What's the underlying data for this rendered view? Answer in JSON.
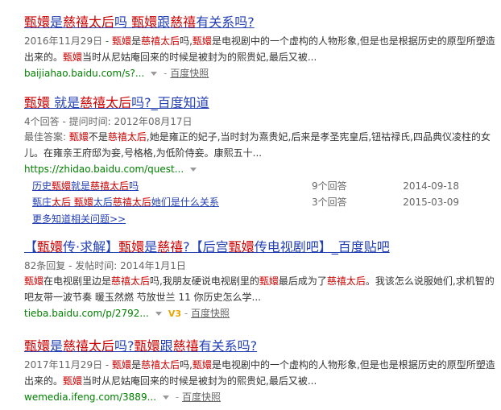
{
  "r1": {
    "title_parts": [
      {
        "t": "甄嬛",
        "h": true
      },
      {
        "t": "是",
        "h": false
      },
      {
        "t": "慈禧太后",
        "h": true
      },
      {
        "t": "吗 ",
        "h": false
      },
      {
        "t": "甄嬛",
        "h": true
      },
      {
        "t": "跟",
        "h": false
      },
      {
        "t": "慈禧",
        "h": true
      },
      {
        "t": "有关系吗?",
        "h": false
      }
    ],
    "abstract_parts": [
      {
        "t": "2016年11月29日 - ",
        "h": false,
        "c": "#666"
      },
      {
        "t": "甄嬛",
        "h": true
      },
      {
        "t": "是",
        "h": false
      },
      {
        "t": "慈禧太后",
        "h": true
      },
      {
        "t": "吗,",
        "h": false
      },
      {
        "t": "甄嬛",
        "h": true
      },
      {
        "t": "是电视剧中的一个虚构的人物形象,但是也是根据历史的原型所塑造出来的。",
        "h": false
      },
      {
        "t": "甄嬛",
        "h": true
      },
      {
        "t": "当时从尼姑庵回来的时候是被封为的熙贵妃,最后又被...",
        "h": false
      }
    ],
    "url": "baijiahao.baidu.com/s?...",
    "snapshot": "百度快照"
  },
  "r2": {
    "title_parts": [
      {
        "t": "甄嬛",
        "h": true
      },
      {
        "t": " 就是",
        "h": false
      },
      {
        "t": "慈禧太后",
        "h": true
      },
      {
        "t": "吗?_百度知道",
        "h": false
      }
    ],
    "meta": "4个回答 - 提问时间: 2012年08月17日",
    "abstract_parts": [
      {
        "t": "最佳答案: ",
        "h": false,
        "c": "#666"
      },
      {
        "t": "甄嬛",
        "h": true
      },
      {
        "t": "不是",
        "h": false
      },
      {
        "t": "慈禧太后",
        "h": true
      },
      {
        "t": ",她是雍正的妃子,当时封为熹贵妃,后来是孝圣宪皇后,钮祜禄氏,四品典仪凌柱的女儿。在雍亲王府邸为妾,号格格,为低阶侍妾。康熙五十...",
        "h": false
      }
    ],
    "url": "https://zhidao.baidu.com/quest...",
    "related": [
      {
        "q_parts": [
          {
            "t": "历史",
            "h": false
          },
          {
            "t": "甄嬛",
            "h": true
          },
          {
            "t": "就是",
            "h": false
          },
          {
            "t": "慈禧太后",
            "h": true
          },
          {
            "t": "吗",
            "h": false
          }
        ],
        "count": "9个回答",
        "date": "2014-09-18"
      },
      {
        "q_parts": [
          {
            "t": "甄庄",
            "h": false
          },
          {
            "t": "太后",
            "h": true
          },
          {
            "t": " ",
            "h": false
          },
          {
            "t": "甄嬛",
            "h": true
          },
          {
            "t": "太后",
            "h": false
          },
          {
            "t": "慈禧太后",
            "h": true
          },
          {
            "t": "她们是什么关系",
            "h": false
          }
        ],
        "count": "3个回答",
        "date": "2015-03-09"
      }
    ],
    "more": "更多知道相关问题>>"
  },
  "r3": {
    "title_parts": [
      {
        "t": "【",
        "h": false
      },
      {
        "t": "甄嬛",
        "h": true
      },
      {
        "t": "传·求解】",
        "h": false
      },
      {
        "t": "甄嬛",
        "h": true
      },
      {
        "t": "是",
        "h": false
      },
      {
        "t": "慈禧",
        "h": true
      },
      {
        "t": "?【后宫",
        "h": false
      },
      {
        "t": "甄嬛",
        "h": true
      },
      {
        "t": "传电视剧吧】_百度贴吧",
        "h": false
      }
    ],
    "meta": "82条回复 - 发帖时间: 2014年1月1日",
    "abstract_parts": [
      {
        "t": "甄嬛",
        "h": true
      },
      {
        "t": "在电视剧里边是",
        "h": false
      },
      {
        "t": "慈禧太后",
        "h": true
      },
      {
        "t": "吗,我朋友硬说电视剧里的",
        "h": false
      },
      {
        "t": "甄嬛",
        "h": true
      },
      {
        "t": "最后成为了",
        "h": false
      },
      {
        "t": "慈禧太后",
        "h": true
      },
      {
        "t": "。我该怎么说服她们,求机智的吧友带一波节奏 暖玉然燃 芍放世兰 11 你历史怎么学...",
        "h": false
      }
    ],
    "url": "tieba.baidu.com/p/2792...",
    "badge": "V3",
    "snapshot": "百度快照"
  },
  "r4": {
    "title_parts": [
      {
        "t": "甄嬛",
        "h": true
      },
      {
        "t": "是",
        "h": false
      },
      {
        "t": "慈禧太后",
        "h": true
      },
      {
        "t": "吗?",
        "h": false
      },
      {
        "t": "甄嬛",
        "h": true
      },
      {
        "t": "跟",
        "h": false
      },
      {
        "t": "慈禧",
        "h": true
      },
      {
        "t": "有关系吗?",
        "h": false
      }
    ],
    "abstract_parts": [
      {
        "t": "2017年11月29日 - ",
        "h": false,
        "c": "#666"
      },
      {
        "t": "甄嬛",
        "h": true
      },
      {
        "t": "是",
        "h": false
      },
      {
        "t": "慈禧太后",
        "h": true
      },
      {
        "t": "吗,",
        "h": false
      },
      {
        "t": "甄嬛",
        "h": true
      },
      {
        "t": "是电视剧中的一个虚构的人物形象,但是也是根据历史的原型所塑造出来的。",
        "h": false
      },
      {
        "t": "甄嬛",
        "h": true
      },
      {
        "t": "当时从尼姑庵回来的时候是被封为的熙贵妃,最后又被...",
        "h": false
      }
    ],
    "url": "wemedia.ifeng.com/3889...",
    "snapshot": "百度快照"
  },
  "colors": {
    "link": "#2440b3",
    "highlight": "#c00000",
    "url": "#008000"
  }
}
